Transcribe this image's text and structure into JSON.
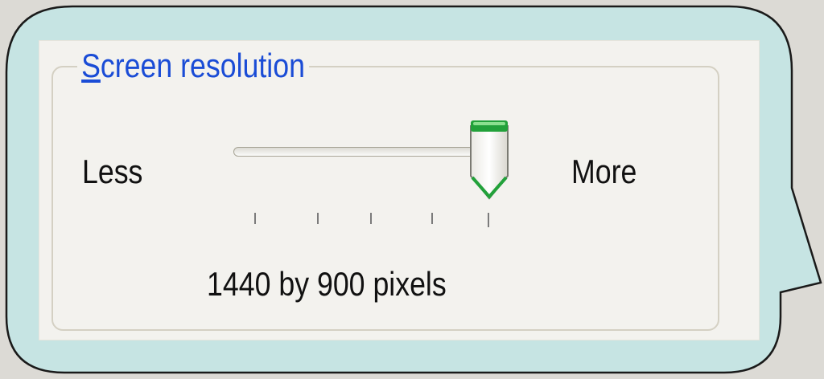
{
  "resolution_group": {
    "title_mnemonic": "S",
    "title_rest": "creen resolution",
    "less_label": "Less",
    "more_label": "More",
    "value_text": "1440 by 900 pixels",
    "slider": {
      "positions": 5,
      "selected_index": 4,
      "position_fraction": 1.0
    }
  },
  "colors": {
    "bubble_fill": "#c6e4e3",
    "bubble_border": "#1a1a1a",
    "page_background": "#dcdad5",
    "title_text": "#1a4cd6",
    "thumb_accent": "#22a13a"
  }
}
